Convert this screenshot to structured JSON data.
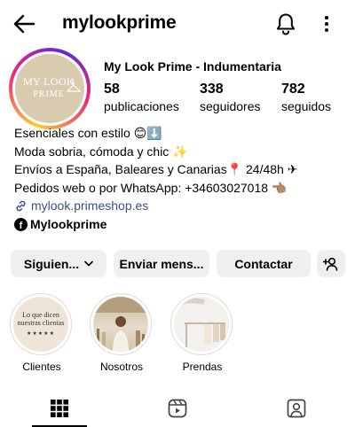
{
  "header": {
    "username": "mylookprime",
    "icons": [
      "back-arrow-icon",
      "bell-icon",
      "more-vertical-icon"
    ]
  },
  "profile": {
    "avatar_text_line1": "MY LOOK",
    "avatar_text_line2": "PRIME",
    "display_name": "My Look Prime - Indumentaria",
    "stats": [
      {
        "value": "58",
        "label": "publicaciones"
      },
      {
        "value": "338",
        "label": "seguidores"
      },
      {
        "value": "782",
        "label": "seguidos"
      }
    ],
    "bio_lines": [
      "Esenciales con estilo 😊⬇️",
      "Moda sobria, cómoda y chic ✨",
      "Envíos a España, Baleares y Canarias📍 24/48h ✈",
      "Pedidos web o por WhatsApp: +34603027018 👈🏽"
    ],
    "link": "mylook.primeshop.es",
    "facebook_name": "Mylookprime"
  },
  "actions": {
    "following_label": "Siguien...",
    "message_label": "Enviar mens...",
    "contact_label": "Contactar"
  },
  "highlights": [
    {
      "label": "Clientes",
      "cover_text": "Lo que dicen nuestras clientas",
      "cover_stars": "★★★★★"
    },
    {
      "label": "Nosotros"
    },
    {
      "label": "Prendas"
    }
  ],
  "tabs": [
    "grid-icon",
    "reels-icon",
    "tagged-icon"
  ],
  "colors": {
    "link": "#385185",
    "button_bg": "#efefef",
    "avatar_bg": "#d8cbb0"
  }
}
